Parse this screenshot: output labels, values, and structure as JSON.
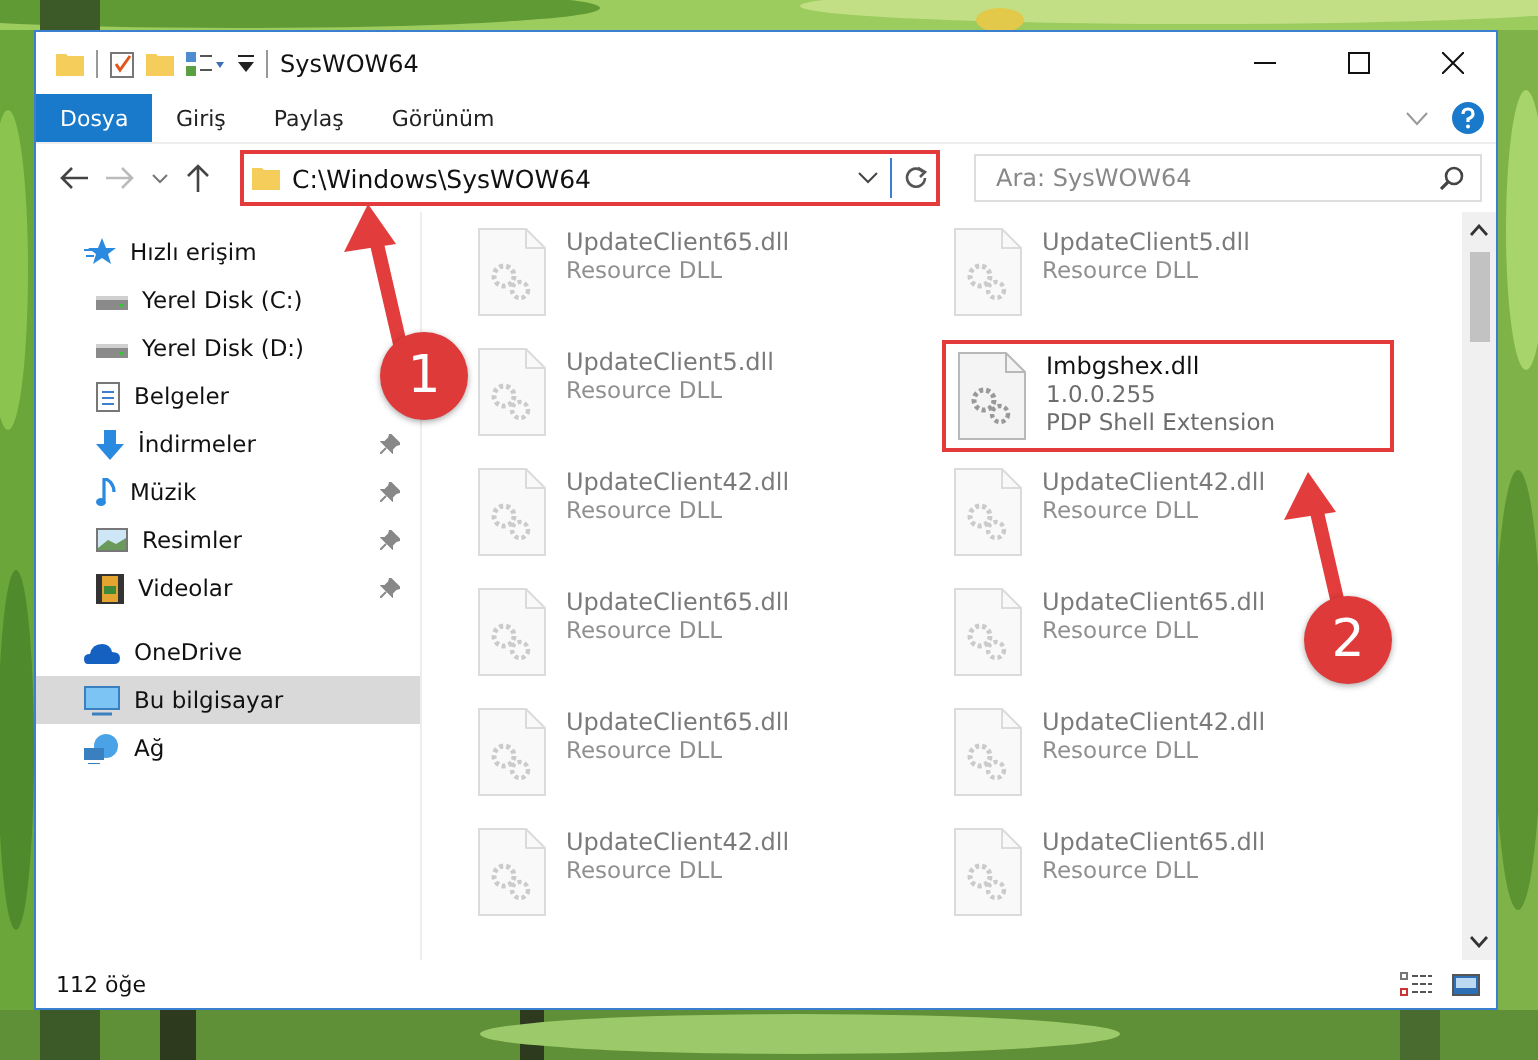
{
  "window": {
    "title": "SysWOW64"
  },
  "ribbon_tabs": [
    {
      "label": "Dosya",
      "selected": true
    },
    {
      "label": "Giriş",
      "selected": false
    },
    {
      "label": "Paylaş",
      "selected": false
    },
    {
      "label": "Görünüm",
      "selected": false
    }
  ],
  "address": {
    "path": "C:\\Windows\\SysWOW64",
    "highlighted": true
  },
  "search": {
    "placeholder": "Ara: SysWOW64"
  },
  "sidebar": {
    "items": [
      {
        "label": "Hızlı erişim",
        "kind": "star",
        "selected": false,
        "children": [
          {
            "label": "Yerel Disk (C:)",
            "kind": "drive",
            "pinned": false,
            "selected": false
          },
          {
            "label": "Yerel Disk (D:)",
            "kind": "drive",
            "pinned": false,
            "selected": false
          },
          {
            "label": "Belgeler",
            "kind": "docs",
            "pinned": false,
            "selected": false
          },
          {
            "label": "İndirmeler",
            "kind": "download",
            "pinned": true,
            "selected": false
          },
          {
            "label": "Müzik",
            "kind": "music",
            "pinned": true,
            "selected": false
          },
          {
            "label": "Resimler",
            "kind": "pictures",
            "pinned": true,
            "selected": false
          },
          {
            "label": "Videolar",
            "kind": "videos",
            "pinned": true,
            "selected": false
          }
        ]
      },
      {
        "label": "OneDrive",
        "kind": "cloud",
        "selected": false
      },
      {
        "label": "Bu bilgisayar",
        "kind": "computer",
        "selected": true
      },
      {
        "label": "Ağ",
        "kind": "network",
        "selected": false
      }
    ]
  },
  "files": [
    {
      "name": "UpdateClient65.dll",
      "description": "Resource DLL",
      "blurred": true,
      "highlighted": false
    },
    {
      "name": "UpdateClient5.dll",
      "description": "Resource DLL",
      "blurred": true,
      "highlighted": false
    },
    {
      "name": "UpdateClient5.dll",
      "description": "Resource DLL",
      "blurred": true,
      "highlighted": false
    },
    {
      "name": "Imbgshex.dll",
      "version": "1.0.0.255",
      "description": "PDP Shell Extension",
      "blurred": false,
      "highlighted": true
    },
    {
      "name": "UpdateClient42.dll",
      "description": "Resource DLL",
      "blurred": true,
      "highlighted": false
    },
    {
      "name": "UpdateClient42.dll",
      "description": "Resource DLL",
      "blurred": true,
      "highlighted": false
    },
    {
      "name": "UpdateClient65.dll",
      "description": "Resource DLL",
      "blurred": true,
      "highlighted": false
    },
    {
      "name": "UpdateClient65.dll",
      "description": "Resource DLL",
      "blurred": true,
      "highlighted": false
    },
    {
      "name": "UpdateClient65.dll",
      "description": "Resource DLL",
      "blurred": true,
      "highlighted": false
    },
    {
      "name": "UpdateClient42.dll",
      "description": "Resource DLL",
      "blurred": true,
      "highlighted": false
    },
    {
      "name": "UpdateClient42.dll",
      "description": "Resource DLL",
      "blurred": true,
      "highlighted": false
    },
    {
      "name": "UpdateClient65.dll",
      "description": "Resource DLL",
      "blurred": true,
      "highlighted": false
    }
  ],
  "status_bar": {
    "count": "112 öğe"
  },
  "callouts": [
    {
      "label": "1"
    },
    {
      "label": "2"
    }
  ]
}
